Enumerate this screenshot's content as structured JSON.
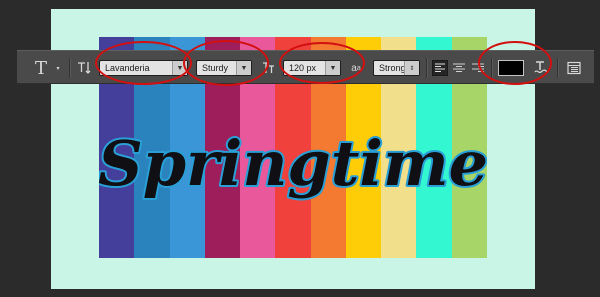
{
  "canvas": {
    "background": "#c8f5e6",
    "stripe_colors": [
      "#443f9a",
      "#2b83be",
      "#3a96d6",
      "#9d1e5a",
      "#e8589b",
      "#f0413d",
      "#f57a31",
      "#ffcc08",
      "#f2df8c",
      "#33f7d0",
      "#a8d568"
    ],
    "artwork_text": "Springtime",
    "text_color": "#0f0f14",
    "outline_color": "#2a9fd6"
  },
  "toolbar": {
    "type_tool_icon": "T",
    "orientation_icon": "text-orientation-icon",
    "font_family": "Lavanderia",
    "font_style": "Sturdy",
    "font_size": "120 px",
    "antialias_prefix": "a",
    "antialias": "Strong",
    "text_color": "#000000",
    "warp_icon": "warp-text-icon",
    "panels_icon": "character-panel-icon"
  },
  "highlight_color": "#d21010"
}
